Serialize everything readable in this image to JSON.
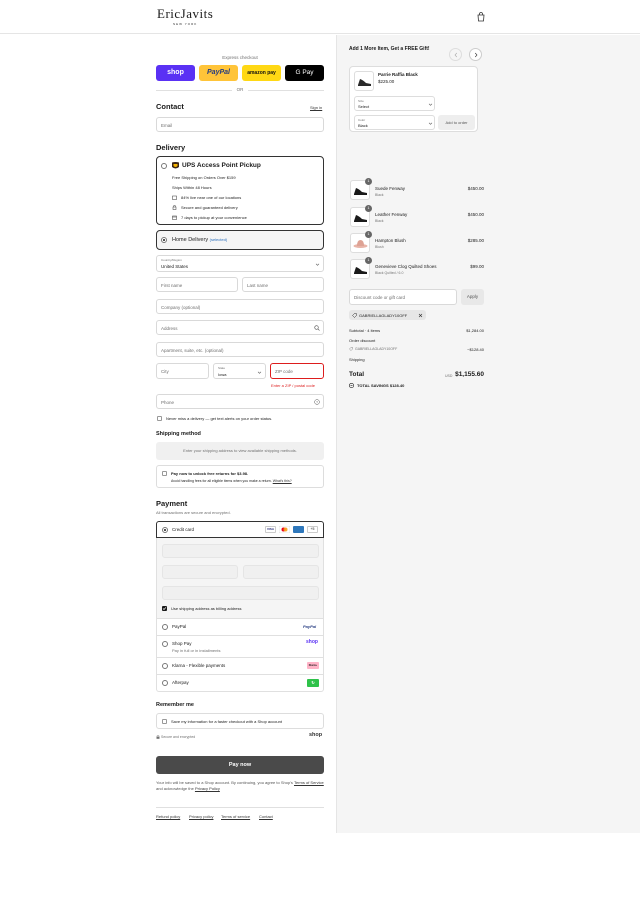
{
  "header": {
    "logo_main": "EricJavits",
    "logo_sub": "NEW YORK",
    "cart_icon": "shopping-bag-icon"
  },
  "express": {
    "title": "Express checkout",
    "shop_label": "shop",
    "paypal_label": "PayPal",
    "amazon_label": "amazon pay",
    "gpay_label": "G Pay",
    "or_label": "OR"
  },
  "contact": {
    "heading": "Contact",
    "signin": "Sign in",
    "email_placeholder": "Email"
  },
  "delivery": {
    "heading": "Delivery",
    "ups": {
      "title": "UPS Access Point Pickup",
      "line1": "Free Shipping on Orders Over $159",
      "line2": "Ships Within 48 Hours",
      "bullet1": "84% live near one of our locations",
      "bullet2": "Secure and guaranteed delivery",
      "bullet3": "7 days to pickup at your convenience"
    },
    "home": {
      "title": "Home Delivery",
      "selected": "(selected)"
    },
    "country_label": "Country/Region",
    "country_value": "United States",
    "first_name": "First name",
    "last_name": "Last name",
    "company": "Company (optional)",
    "address": "Address",
    "apartment": "Apartment, suite, etc. (optional)",
    "city": "City",
    "state_label": "State",
    "state_value": "Iowa",
    "zip": "ZIP code",
    "zip_error": "Enter a ZIP / postal code",
    "phone": "Phone",
    "sms_label": "Never miss a delivery — get text alerts on your order status."
  },
  "shipping_method": {
    "heading": "Shipping method",
    "placeholder": "Enter your shipping address to view available shipping methods.",
    "returns_title": "Pay now to unlock free returns for $3.98.",
    "returns_desc": "Avoid handling fees for all eligible items when you make a return.",
    "returns_link": "What's this?"
  },
  "payment": {
    "heading": "Payment",
    "subtitle": "All transactions are secure and encrypted.",
    "credit_card": "Credit card",
    "card_more": "+5",
    "billing_same": "Use shipping address as billing address",
    "paypal": "PayPal",
    "paypal_logo": "PayPal",
    "shoppay": "Shop Pay",
    "shoppay_sub": "Pay in full or in installments",
    "shoppay_logo": "shop",
    "klarna": "Klarna - Flexible payments",
    "klarna_logo": "Klarna.",
    "afterpay": "Afterpay",
    "afterpay_logo": "↻"
  },
  "remember": {
    "heading": "Remember me",
    "label": "Save my information for a faster checkout with a Shop account",
    "secure": "Secure and encrypted",
    "shop_logo": "shop"
  },
  "pay_button": "Pay now",
  "legal": {
    "text": "Your info will be saved to a Shop account. By continuing, you agree to Shop's",
    "terms": "Terms of Service",
    "and": "and acknowledge the",
    "privacy": "Privacy Policy"
  },
  "footer_links": [
    "Refund policy",
    "Privacy policy",
    "Terms of service",
    "Contact"
  ],
  "upsell": {
    "title": "Add 1 More Item, Get a FREE Gift!",
    "product_name": "Parrie Raffia Black",
    "product_price": "$225.00",
    "size_label": "Size",
    "size_value": "Select",
    "color_label": "Color",
    "color_value": "Black",
    "add_button": "Add to order"
  },
  "cart": {
    "items": [
      {
        "name": "Suede Fenway",
        "variant": "Black",
        "price": "$450.00",
        "qty": "1"
      },
      {
        "name": "Leather Fenway",
        "variant": "Black",
        "price": "$450.00",
        "qty": "1"
      },
      {
        "name": "Hampton Blush",
        "variant": "Blush",
        "price": "$285.00",
        "qty": "1"
      },
      {
        "name": "Genevieve Clog Quilted Shoes",
        "variant": "Black Quilted / 6.0",
        "price": "$99.00",
        "qty": "1"
      }
    ],
    "discount_placeholder": "Discount code or gift card",
    "apply": "Apply",
    "applied_code": "GABRIELLAGLADY10OFF",
    "subtotal_label": "Subtotal · 4 items",
    "subtotal_value": "$1,284.00",
    "order_discount_label": "Order discount",
    "discount_code": "GABRIELLAGLADY10OFF",
    "discount_value": "−$128.40",
    "shipping_label": "Shipping",
    "total_label": "Total",
    "currency": "USD",
    "total_value": "$1,155.60",
    "savings_label": "TOTAL SAVINGS",
    "savings_value": "$128.40"
  },
  "colors": {
    "shop_purple": "#5a31f4",
    "paypal_yellow": "#ffc439",
    "amazon_yellow": "#ffd814",
    "error_red": "#dd1d1d",
    "pay_button": "#4a4a4a"
  }
}
